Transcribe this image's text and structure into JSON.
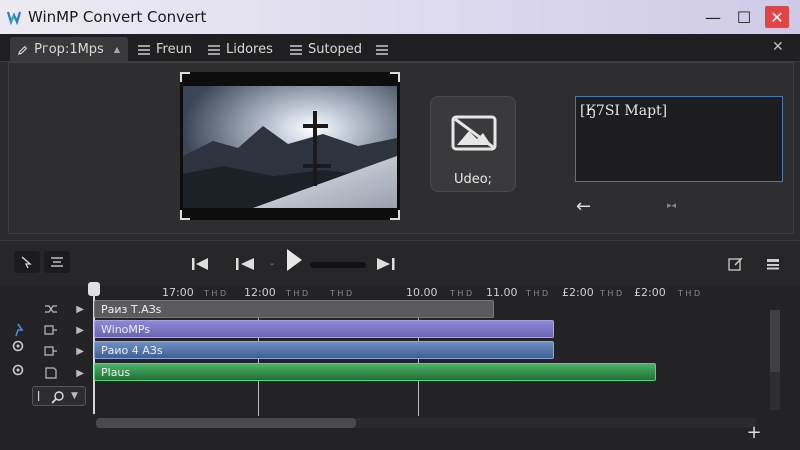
{
  "window": {
    "title": "WinMP Convert Convert",
    "controls": {
      "minimize": "—",
      "maximize": "☐",
      "close": "✕"
    }
  },
  "tabs": [
    {
      "label": "Ргор:1Мрs",
      "icon": "edit-icon",
      "active": true
    },
    {
      "label": "Freun",
      "icon": "menu-icon",
      "active": false
    },
    {
      "label": "Lidores",
      "icon": "menu-icon",
      "active": false
    },
    {
      "label": "Sutoped",
      "icon": "menu-icon",
      "active": false
    }
  ],
  "tab_close": "✕",
  "preview": {
    "video_card_label": "Udeo;",
    "map_text": "[Ӄ7SI Mapt]",
    "back_arrow": "←",
    "mini_dots": "▸◂"
  },
  "timeline": {
    "ruler_ticks": [
      "17:00",
      "12:00",
      "10.00",
      "11.00",
      "£2:00",
      "£2:00"
    ],
    "ruler_minor": [
      "T H D",
      "T H D",
      "T H D",
      "T H D",
      "T H D",
      "T H D",
      "T H D"
    ],
    "tracks": [
      {
        "name": "Раиз Т.АЗs",
        "color": "#5b5b5f"
      },
      {
        "name": "WinoMPs",
        "color": "#7e78c4"
      },
      {
        "name": "Раио 4 АЗs",
        "color": "#4f6fa3"
      },
      {
        "name": "Plaus",
        "color": "#2f8a48"
      }
    ],
    "add_label": "+"
  }
}
